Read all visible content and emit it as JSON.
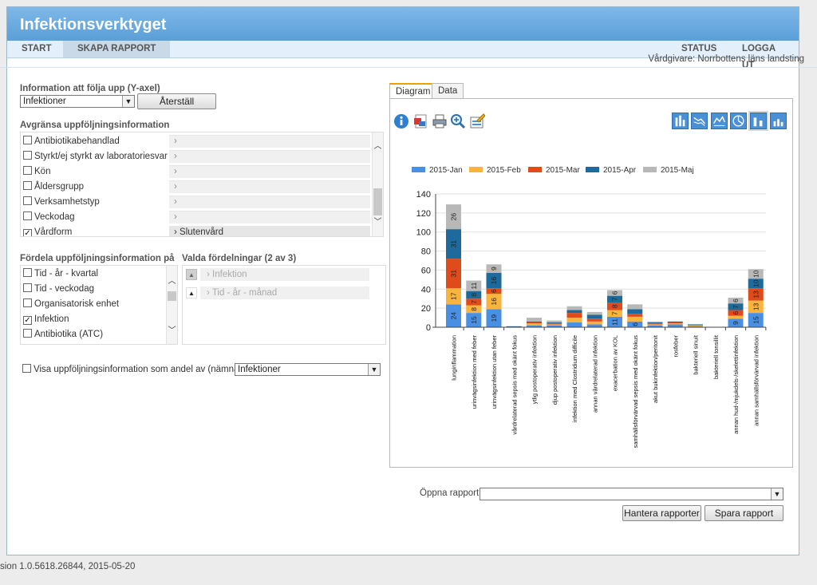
{
  "app": {
    "title": "Infektionsverktyget"
  },
  "nav": {
    "start": "START",
    "create_report": "SKAPA RAPPORT",
    "status": "STATUS",
    "logout": "LOGGA UT"
  },
  "provider": "Vårdgivare: Norrbottens läns landsting",
  "yaxis": {
    "label": "Information att följa upp (Y-axel)",
    "value": "Infektioner",
    "reset": "Återställ"
  },
  "limit": {
    "label": "Avgränsa uppföljningsinformation",
    "items": [
      {
        "label": "Antibiotikabehandlad",
        "checked": false,
        "value": ""
      },
      {
        "label": "Styrkt/ej styrkt av laboratoriesvar",
        "checked": false,
        "value": ""
      },
      {
        "label": "Kön",
        "checked": false,
        "value": ""
      },
      {
        "label": "Åldersgrupp",
        "checked": false,
        "value": ""
      },
      {
        "label": "Verksamhetstyp",
        "checked": false,
        "value": ""
      },
      {
        "label": "Veckodag",
        "checked": false,
        "value": ""
      },
      {
        "label": "Vårdform",
        "checked": true,
        "value": "Slutenvård"
      }
    ]
  },
  "distribute": {
    "label": "Fördela uppföljningsinformation på",
    "items": [
      {
        "label": "Tid - år - kvartal",
        "checked": false
      },
      {
        "label": "Tid - veckodag",
        "checked": false
      },
      {
        "label": "Organisatorisk enhet",
        "checked": false
      },
      {
        "label": "Infektion",
        "checked": true
      },
      {
        "label": "Antibiotika (ATC)",
        "checked": false
      }
    ]
  },
  "selected": {
    "label": "Valda fördelningar (2 av 3)",
    "items": [
      "Infektion",
      "Tid - år - månad"
    ]
  },
  "share": {
    "label": "Visa uppföljningsinformation som andel av (nämnare)",
    "value": "Infektioner"
  },
  "tabs": {
    "diagram": "Diagram",
    "data": "Data"
  },
  "report": {
    "open_label": "Öppna rapport",
    "open_value": "",
    "manage": "Hantera rapporter",
    "save": "Spara rapport"
  },
  "version": "sion 1.0.5618.26844, 2015-05-20",
  "colors": {
    "Jan": "#4a90e2",
    "Feb": "#f8b43c",
    "Mar": "#e04b1c",
    "Apr": "#1e6a9c",
    "Maj": "#b8b8b8"
  },
  "chart_data": {
    "type": "bar",
    "stacked": true,
    "title": "",
    "xlabel": "",
    "ylabel": "",
    "ylim": [
      0,
      140
    ],
    "yticks": [
      0,
      20,
      40,
      60,
      80,
      100,
      120,
      140
    ],
    "legend_position": "top",
    "grid": true,
    "categories": [
      "lunginflammation",
      "urinvägsinfektion med feber",
      "urinvägsinfektion utan feber",
      "vårdrelaterad sepsis med okänt fokus",
      "ytlig postoperativ infektion",
      "djup postoperativ infektion",
      "infektion med Clostridium difficile",
      "annan vårdrelaterad infektion",
      "exacerbation av KOL",
      "samhällsförvärvad sepsis med okänt fokus",
      "akut bukinfektion/peritonit",
      "rosfeber",
      "bakteriell sinuit",
      "bakteriell tonsillit",
      "annan hud-/mjukdels-/skelettinfektion",
      "annan samhällsförvärvad infektion"
    ],
    "series": [
      {
        "name": "2015-Jan",
        "color": "#4a90e2",
        "values": [
          24,
          15,
          19,
          0,
          2,
          2,
          5,
          3,
          11,
          6,
          2,
          3,
          1,
          0,
          9,
          15
        ]
      },
      {
        "name": "2015-Feb",
        "color": "#f8b43c",
        "values": [
          17,
          8,
          16,
          0,
          2,
          1,
          5,
          3,
          7,
          5,
          1,
          1,
          1,
          0,
          3,
          13
        ]
      },
      {
        "name": "2015-Mar",
        "color": "#e04b1c",
        "values": [
          31,
          7,
          6,
          0,
          1,
          1,
          5,
          3,
          8,
          3,
          1,
          1,
          0,
          0,
          6,
          13
        ]
      },
      {
        "name": "2015-Apr",
        "color": "#1e6a9c",
        "values": [
          31,
          8,
          16,
          1,
          1,
          1,
          3,
          4,
          7,
          5,
          1,
          1,
          1,
          0,
          7,
          10
        ]
      },
      {
        "name": "2015-Maj",
        "color": "#b8b8b8",
        "values": [
          26,
          11,
          9,
          0,
          4,
          2,
          4,
          3,
          6,
          5,
          1,
          0,
          0,
          0,
          6,
          10
        ]
      }
    ]
  }
}
